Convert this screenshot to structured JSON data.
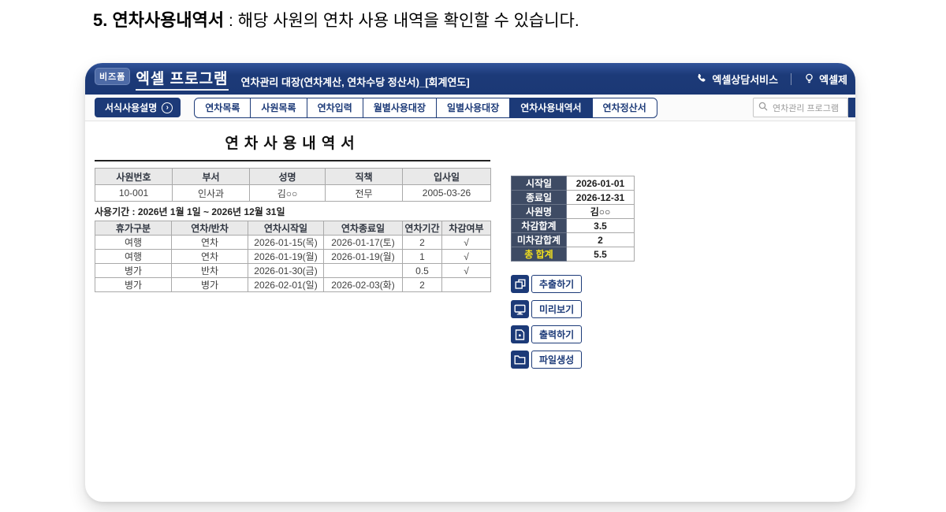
{
  "page_heading": {
    "bold": "5. 연차사용내역서",
    "rest": " : 해당 사원의 연차 사용 내역을 확인할 수 있습니다."
  },
  "header": {
    "logo_badge": "비즈폼",
    "app_title": "엑셀 프로그램",
    "subtitle": "연차관리 대장(연차계산, 연차수당 정산서)_[회계연도]",
    "phone_link": "엑셀상담서비스",
    "bulb_link": "엑셀제"
  },
  "nav": {
    "guide_button": "서식사용설명",
    "tabs": [
      {
        "label": "연차목록",
        "active": false
      },
      {
        "label": "사원목록",
        "active": false
      },
      {
        "label": "연차입력",
        "active": false
      },
      {
        "label": "월별사용대장",
        "active": false
      },
      {
        "label": "일별사용대장",
        "active": false
      },
      {
        "label": "연차사용내역서",
        "active": true
      },
      {
        "label": "연차정산서",
        "active": false
      }
    ],
    "search_placeholder": "연차관리 프로그램"
  },
  "content": {
    "doc_title": "연차사용내역서",
    "employee_table": {
      "headers": [
        "사원번호",
        "부서",
        "성명",
        "직책",
        "입사일"
      ],
      "row": [
        "10-001",
        "인사과",
        "김○○",
        "전무",
        "2005-03-26"
      ]
    },
    "period_label": "사용기간 : 2026년 1월 1일 ~ 2026년 12월 31일",
    "usage_table": {
      "headers": [
        "휴가구분",
        "연차/반차",
        "연차시작일",
        "연차종료일",
        "연차기간",
        "차감여부"
      ],
      "rows": [
        [
          "여행",
          "연차",
          "2026-01-15(목)",
          "2026-01-17(토)",
          "2",
          "√"
        ],
        [
          "여행",
          "연차",
          "2026-01-19(월)",
          "2026-01-19(월)",
          "1",
          "√"
        ],
        [
          "병가",
          "반차",
          "2026-01-30(금)",
          "",
          "0.5",
          "√"
        ],
        [
          "병가",
          "병가",
          "2026-02-01(일)",
          "2026-02-03(화)",
          "2",
          ""
        ]
      ]
    },
    "summary_table": {
      "rows": [
        {
          "label": "시작일",
          "value": "2026-01-01",
          "highlight": false
        },
        {
          "label": "종료일",
          "value": "2026-12-31",
          "highlight": false
        },
        {
          "label": "사원명",
          "value": "김○○",
          "highlight": false
        },
        {
          "label": "차감합계",
          "value": "3.5",
          "highlight": false
        },
        {
          "label": "미차감합계",
          "value": "2",
          "highlight": false
        },
        {
          "label": "총 합계",
          "value": "5.5",
          "highlight": true
        }
      ]
    },
    "action_buttons": [
      {
        "label": "추출하기",
        "icon": "extract-icon"
      },
      {
        "label": "미리보기",
        "icon": "preview-icon"
      },
      {
        "label": "출력하기",
        "icon": "print-icon"
      },
      {
        "label": "파일생성",
        "icon": "file-create-icon"
      }
    ]
  },
  "colors": {
    "navy": "#1c3a78",
    "summary_label_bg": "#3e4b64",
    "total_highlight": "#f4e11b",
    "table_header_bg": "#e9e9e9"
  }
}
